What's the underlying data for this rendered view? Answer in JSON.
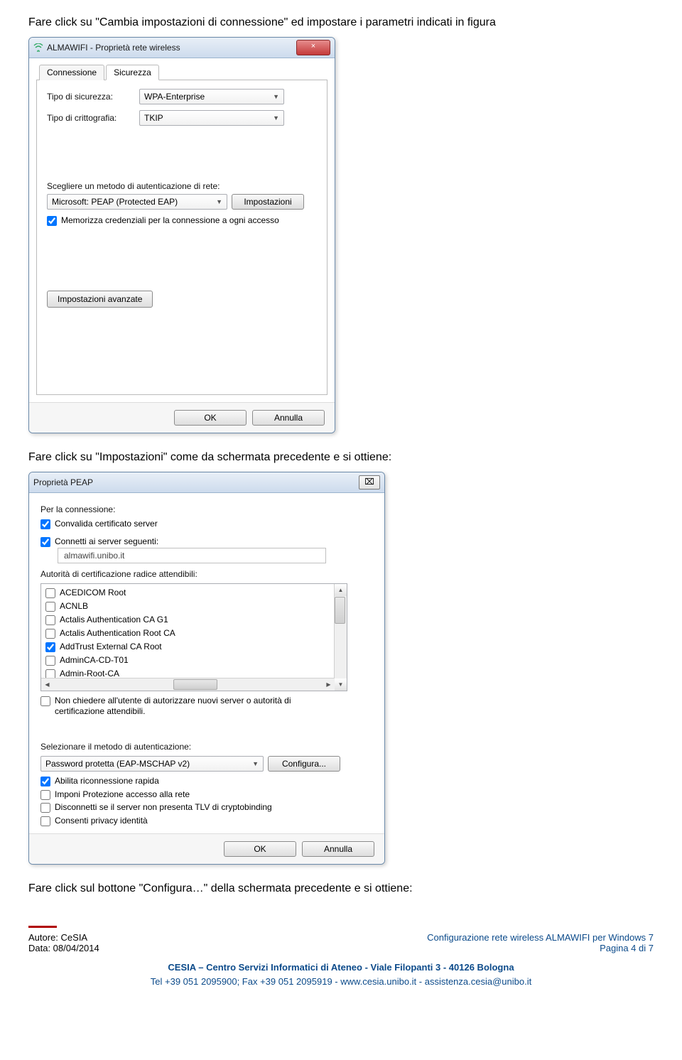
{
  "instruction1": "Fare click su \"Cambia impostazioni di connessione\" ed impostare i parametri indicati in figura",
  "dialog1": {
    "title": "ALMAWIFI - Proprietà rete wireless",
    "tab_conn": "Connessione",
    "tab_sec": "Sicurezza",
    "lbl_sectype": "Tipo di sicurezza:",
    "val_sectype": "WPA-Enterprise",
    "lbl_crypt": "Tipo di crittografia:",
    "val_crypt": "TKIP",
    "lbl_authmethod": "Scegliere un metodo di autenticazione di rete:",
    "val_authmethod": "Microsoft: PEAP (Protected EAP)",
    "btn_settings": "Impostazioni",
    "chk_remember": "Memorizza credenziali per la connessione a ogni accesso",
    "btn_advanced": "Impostazioni avanzate",
    "btn_ok": "OK",
    "btn_cancel": "Annulla",
    "close_x": "×"
  },
  "instruction2": "Fare click su \"Impostazioni\" come da schermata precedente e si ottiene:",
  "dialog2": {
    "title": "Proprietà PEAP",
    "close_sigma": "⌧",
    "lbl_forconn": "Per la connessione:",
    "chk_validate": "Convalida certificato server",
    "chk_connect": "Connetti ai server seguenti:",
    "txt_server": "almawifi.unibo.it",
    "lbl_rootca": "Autorità di certificazione radice attendibili:",
    "ca_items": [
      {
        "label": "ACEDICOM Root",
        "checked": false
      },
      {
        "label": "ACNLB",
        "checked": false
      },
      {
        "label": "Actalis Authentication CA G1",
        "checked": false
      },
      {
        "label": "Actalis Authentication Root CA",
        "checked": false
      },
      {
        "label": "AddTrust External CA Root",
        "checked": true
      },
      {
        "label": "AdminCA-CD-T01",
        "checked": false
      },
      {
        "label": "Admin-Root-CA",
        "checked": false
      }
    ],
    "chk_noprompt": "Non chiedere all'utente di autorizzare nuovi server o autorità di certificazione attendibili.",
    "lbl_selauth": "Selezionare il metodo di autenticazione:",
    "val_authmethod": "Password protetta (EAP-MSCHAP v2)",
    "btn_configure": "Configura...",
    "chk_fastreconn": "Abilita riconnessione rapida",
    "chk_nap": "Imponi Protezione accesso alla rete",
    "chk_disconnect_tlv": "Disconnetti se il server non presenta TLV di cryptobinding",
    "chk_privacy": "Consenti privacy identità",
    "btn_ok": "OK",
    "btn_cancel": "Annulla"
  },
  "instruction3": "Fare click sul  bottone \"Configura…\" della schermata precedente e si ottiene:",
  "footer": {
    "author_label": "Autore: CeSIA",
    "date_label": "Data: 08/04/2014",
    "right1": "Configurazione rete wireless ALMAWIFI per Windows 7",
    "right2": "Pagina 4 di 7",
    "center1": "CESIA – Centro Servizi Informatici di Ateneo -  Viale Filopanti 3 - 40126 Bologna",
    "center2": "Tel +39 051 2095900; Fax +39 051 2095919 - www.cesia.unibo.it - assistenza.cesia@unibo.it"
  }
}
